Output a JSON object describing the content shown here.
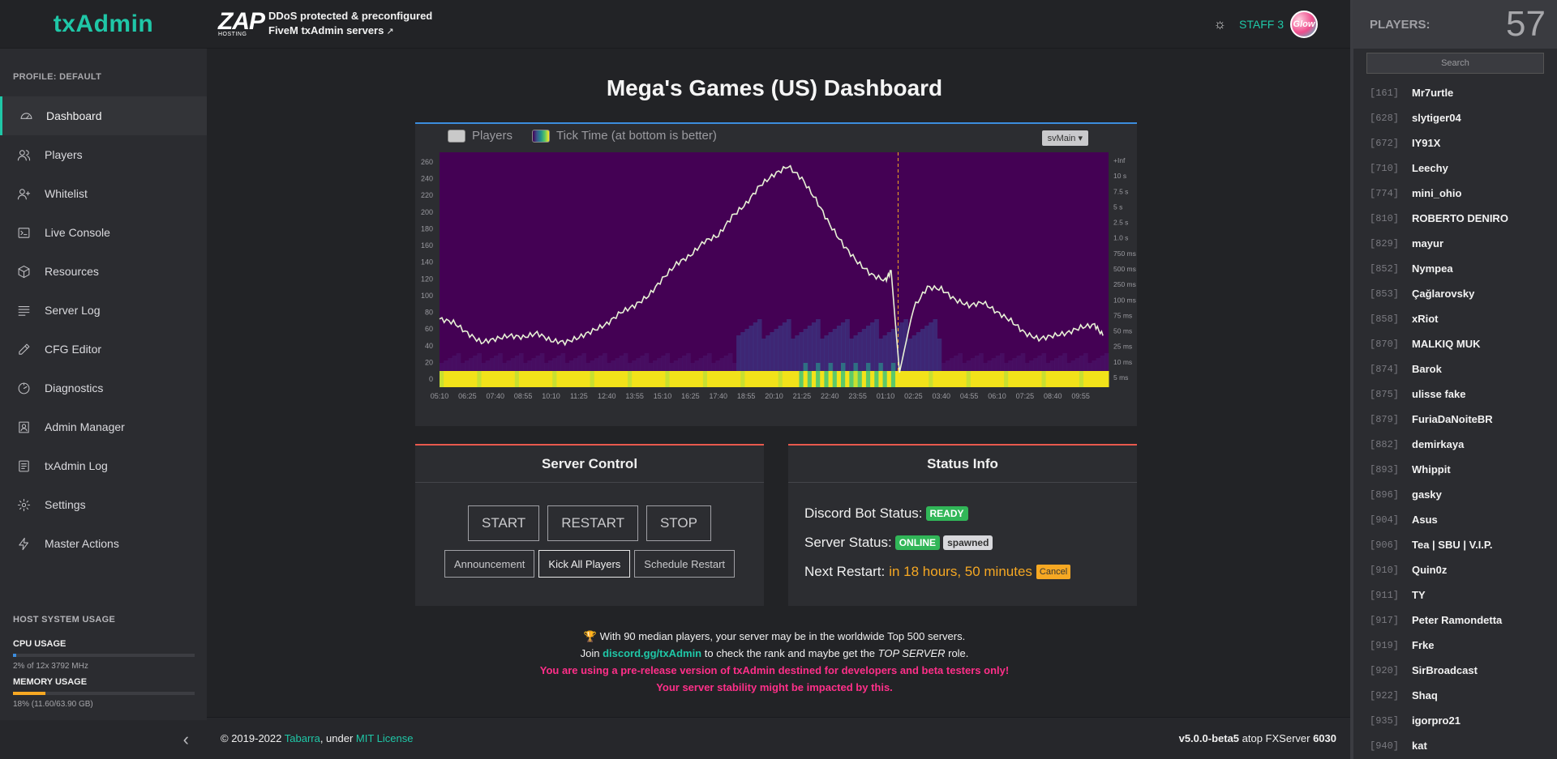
{
  "brand": "txAdmin",
  "sidebar": {
    "profile": "PROFILE: DEFAULT",
    "items": [
      {
        "label": "Dashboard"
      },
      {
        "label": "Players"
      },
      {
        "label": "Whitelist"
      },
      {
        "label": "Live Console"
      },
      {
        "label": "Resources"
      },
      {
        "label": "Server Log"
      },
      {
        "label": "CFG Editor"
      },
      {
        "label": "Diagnostics"
      },
      {
        "label": "Admin Manager"
      },
      {
        "label": "txAdmin Log"
      },
      {
        "label": "Settings"
      },
      {
        "label": "Master Actions"
      }
    ],
    "host_usage": {
      "title": "HOST SYSTEM USAGE",
      "cpu_label": "CPU USAGE",
      "cpu_text": "2% of 12x 3792 MHz",
      "cpu_percent": 2,
      "cpu_color": "#3c8dde",
      "mem_label": "MEMORY USAGE",
      "mem_text": "18% (11.60/63.90 GB)",
      "mem_percent": 18,
      "mem_color": "#f6a823"
    },
    "collapse_icon": "chevron-left-icon"
  },
  "header": {
    "zap_logo": "ZAP",
    "zap_logo_sub": "HOSTING",
    "zap_line1": "DDoS protected & preconfigured",
    "zap_line2": "FiveM txAdmin servers",
    "staff_name": "STAFF 3",
    "avatar_text": "Glow"
  },
  "main": {
    "title": "Mega's Games (US) Dashboard",
    "chart": {
      "legend_players": "Players",
      "legend_tick": "Tick Time (at bottom is better)",
      "thread_select": "svMain"
    },
    "server_control": {
      "title": "Server Control",
      "start": "START",
      "restart": "RESTART",
      "stop": "STOP",
      "announcement": "Announcement",
      "kick_all": "Kick All Players",
      "schedule_restart": "Schedule Restart"
    },
    "status_info": {
      "title": "Status Info",
      "discord_label": "Discord Bot Status:",
      "discord_value": "READY",
      "server_label": "Server Status:",
      "server_value": "ONLINE",
      "server_sub": "spawned",
      "restart_label": "Next Restart:",
      "restart_value": "in 18 hours, 50 minutes",
      "cancel": "Cancel"
    },
    "notice": {
      "trophy": "🏆",
      "line1": " With 90 median players, your server may be in the worldwide Top 500 servers.",
      "line2_a": "Join ",
      "line2_link": "discord.gg/txAdmin",
      "line2_b": " to check the rank and maybe get the ",
      "line2_ital": "TOP SERVER",
      "line2_c": " role.",
      "warn1": "You are using a pre-release version of txAdmin destined for developers and beta testers only!",
      "warn2": "Your server stability might be impacted by this."
    }
  },
  "footer": {
    "copy": "© 2019-2022 ",
    "author": "Tabarra",
    "under": ", under ",
    "license": "MIT License",
    "version": "v5.0.0-beta5",
    "atop": " atop FXServer ",
    "fx_version": "6030"
  },
  "players_panel": {
    "label": "PLAYERS:",
    "count": "57",
    "search_placeholder": "Search",
    "players": [
      {
        "id": "[161]",
        "name": "Mr7urtle"
      },
      {
        "id": "[628]",
        "name": "slytiger04"
      },
      {
        "id": "[672]",
        "name": "IY91X"
      },
      {
        "id": "[710]",
        "name": "Leechy"
      },
      {
        "id": "[774]",
        "name": "mini_ohio"
      },
      {
        "id": "[810]",
        "name": "ROBERTO DENIRO"
      },
      {
        "id": "[829]",
        "name": "mayur"
      },
      {
        "id": "[852]",
        "name": "Nympea"
      },
      {
        "id": "[853]",
        "name": "Çağlarovsky"
      },
      {
        "id": "[858]",
        "name": "xRiot"
      },
      {
        "id": "[870]",
        "name": "MALKIQ MUK"
      },
      {
        "id": "[874]",
        "name": "Barok"
      },
      {
        "id": "[875]",
        "name": "ulisse fake"
      },
      {
        "id": "[879]",
        "name": "FuriaDaNoiteBR"
      },
      {
        "id": "[882]",
        "name": "demirkaya"
      },
      {
        "id": "[893]",
        "name": "Whippit"
      },
      {
        "id": "[896]",
        "name": "gasky"
      },
      {
        "id": "[904]",
        "name": "Asus"
      },
      {
        "id": "[906]",
        "name": "Tea | SBU | V.I.P."
      },
      {
        "id": "[910]",
        "name": "Quin0z"
      },
      {
        "id": "[911]",
        "name": "TY"
      },
      {
        "id": "[917]",
        "name": "Peter Ramondetta"
      },
      {
        "id": "[919]",
        "name": "Frke"
      },
      {
        "id": "[920]",
        "name": "SirBroadcast"
      },
      {
        "id": "[922]",
        "name": "Shaq"
      },
      {
        "id": "[935]",
        "name": "igorpro21"
      },
      {
        "id": "[940]",
        "name": "kat"
      }
    ]
  },
  "chart_data": {
    "type": "line",
    "y_left_ticks": [
      260,
      240,
      220,
      200,
      180,
      160,
      140,
      120,
      100,
      80,
      60,
      40,
      20,
      0
    ],
    "y_right_ticks": [
      "+Inf",
      "10 s",
      "7.5 s",
      "5 s",
      "2.5 s",
      "1.0 s",
      "750 ms",
      "500 ms",
      "250 ms",
      "100 ms",
      "75 ms",
      "50 ms",
      "25 ms",
      "10 ms",
      "5 ms"
    ],
    "x_ticks": [
      "05:10",
      "06:25",
      "07:40",
      "08:55",
      "10:10",
      "11:25",
      "12:40",
      "13:55",
      "15:10",
      "16:25",
      "17:40",
      "18:55",
      "20:10",
      "21:25",
      "22:40",
      "23:55",
      "01:10",
      "02:25",
      "03:40",
      "04:55",
      "06:10",
      "07:25",
      "08:40",
      "09:55"
    ],
    "ylim": [
      0,
      260
    ],
    "series": [
      {
        "name": "Players",
        "x": [
          0,
          0.5,
          1,
          1.5,
          2,
          2.5,
          3,
          3.5,
          4,
          4.5,
          5,
          5.5,
          6,
          6.5,
          7,
          7.5,
          8,
          8.5,
          9,
          9.5,
          10,
          10.5,
          11,
          11.5,
          12,
          12.5,
          13,
          13.5,
          14,
          14.5,
          15,
          15.5,
          16,
          16.2,
          16.5,
          17,
          17.5,
          18,
          18.5,
          19,
          19.5,
          20,
          20.5,
          21,
          21.5,
          22,
          22.5,
          23,
          23.5,
          23.8
        ],
        "values": [
          72,
          68,
          55,
          44,
          48,
          52,
          50,
          55,
          46,
          44,
          50,
          58,
          66,
          80,
          88,
          100,
          120,
          138,
          148,
          165,
          172,
          195,
          210,
          232,
          245,
          255,
          240,
          215,
          185,
          160,
          140,
          125,
          118,
          130,
          8,
          85,
          110,
          108,
          95,
          88,
          92,
          80,
          70,
          55,
          48,
          52,
          55,
          62,
          65,
          52
        ]
      }
    ],
    "marker_x": 16.45
  }
}
